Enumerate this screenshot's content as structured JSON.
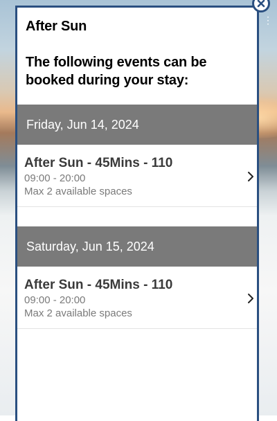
{
  "modal": {
    "title": "After Sun",
    "intro": "The following events can be booked during your stay:"
  },
  "days": [
    {
      "date": "Friday, Jun 14, 2024",
      "events": [
        {
          "name": "After Sun - 45Mins - 110",
          "time": "09:00 - 20:00",
          "spaces": "Max 2 available spaces"
        }
      ]
    },
    {
      "date": "Saturday, Jun 15, 2024",
      "events": [
        {
          "name": "After Sun - 45Mins - 110",
          "time": "09:00 - 20:00",
          "spaces": "Max 2 available spaces"
        }
      ]
    }
  ],
  "icons": {
    "close": "close-icon",
    "chevron": "chevron-right-icon",
    "background_menu": "kebab-menu-icon"
  },
  "colors": {
    "modal_border": "#2a4f80",
    "date_header_bg": "#7a7a7a",
    "event_name": "#3a3a3a",
    "event_meta": "#7a7a7a"
  }
}
